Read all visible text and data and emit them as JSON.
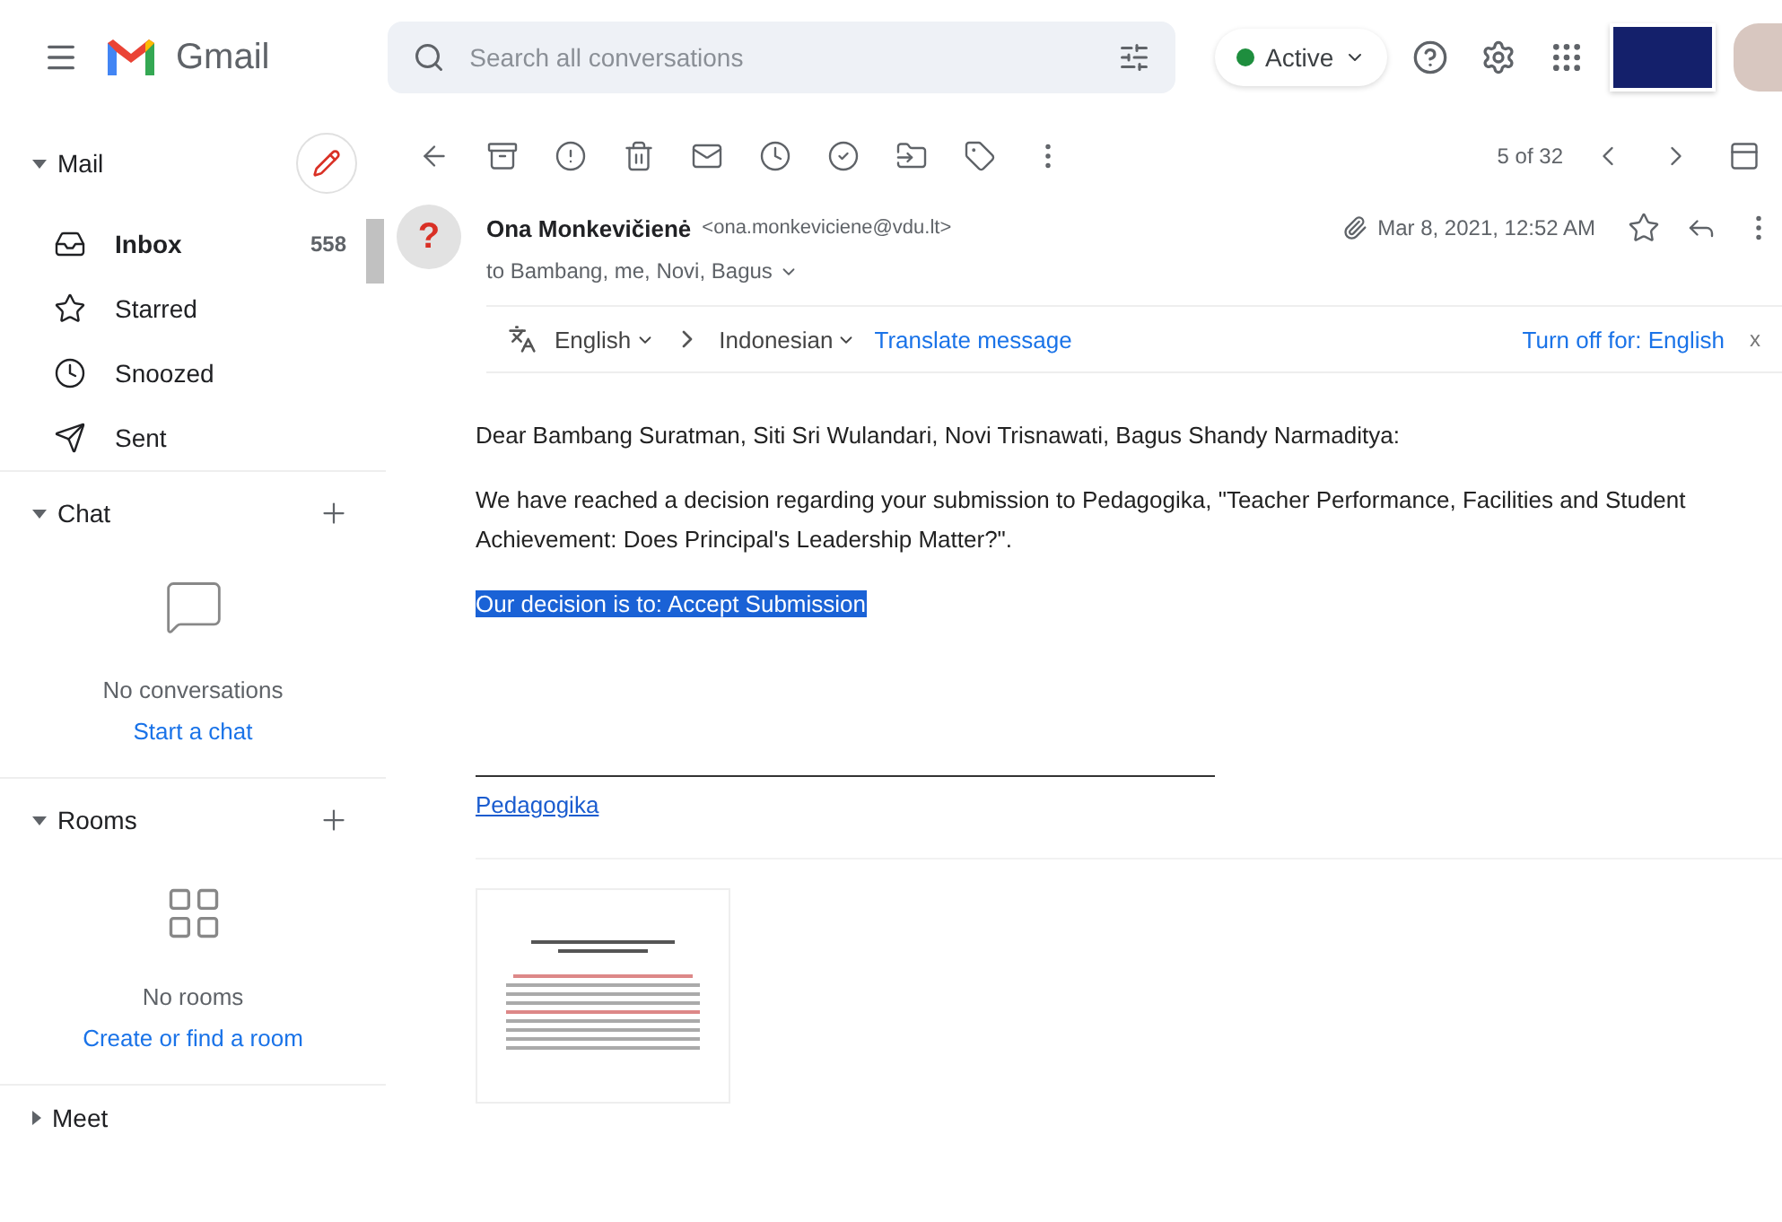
{
  "header": {
    "app_name": "Gmail",
    "search": {
      "placeholder": "Search all conversations"
    },
    "status": {
      "label": "Active",
      "color": "#1e8e3e"
    }
  },
  "sidebar": {
    "sections": [
      {
        "kind": "mail",
        "title": "Mail",
        "expanded": true,
        "items": [
          {
            "label": "Inbox",
            "count": "558",
            "unread": true
          },
          {
            "label": "Starred",
            "unread": false
          },
          {
            "label": "Snoozed",
            "unread": false
          },
          {
            "label": "Sent",
            "unread": false
          }
        ]
      },
      {
        "kind": "chat",
        "title": "Chat",
        "expanded": true,
        "empty_text": "No conversations",
        "action": "Start a chat"
      },
      {
        "kind": "rooms",
        "title": "Rooms",
        "expanded": true,
        "empty_text": "No rooms",
        "action": "Create or find a room"
      },
      {
        "kind": "meet",
        "title": "Meet",
        "expanded": false
      }
    ]
  },
  "toolbar": {
    "position": "5 of 32"
  },
  "message": {
    "avatar_text": "?",
    "sender_name": "Ona Monkevičienė",
    "sender_email": "<ona.monkeviciene@vdu.lt>",
    "recipients": "to Bambang, me, Novi, Bagus",
    "date": "Mar 8, 2021, 12:52 AM",
    "starred": false,
    "translate": {
      "from": "English",
      "to": "Indonesian",
      "action": "Translate message",
      "turn_off": "Turn off for: English",
      "close": "x"
    },
    "paragraphs": [
      {
        "text": "Dear Bambang Suratman, Siti Sri Wulandari, Novi Trisnawati, Bagus Shandy Narmaditya:",
        "highlighted": false
      },
      {
        "text": "We have reached a decision regarding your submission to Pedagogika, \"Teacher Performance, Facilities and Student Achievement: Does Principal's Leadership Matter?\".",
        "highlighted": false
      },
      {
        "text": "Our decision is to: Accept Submission",
        "highlighted": true
      }
    ],
    "signature_link": "Pedagogika"
  }
}
